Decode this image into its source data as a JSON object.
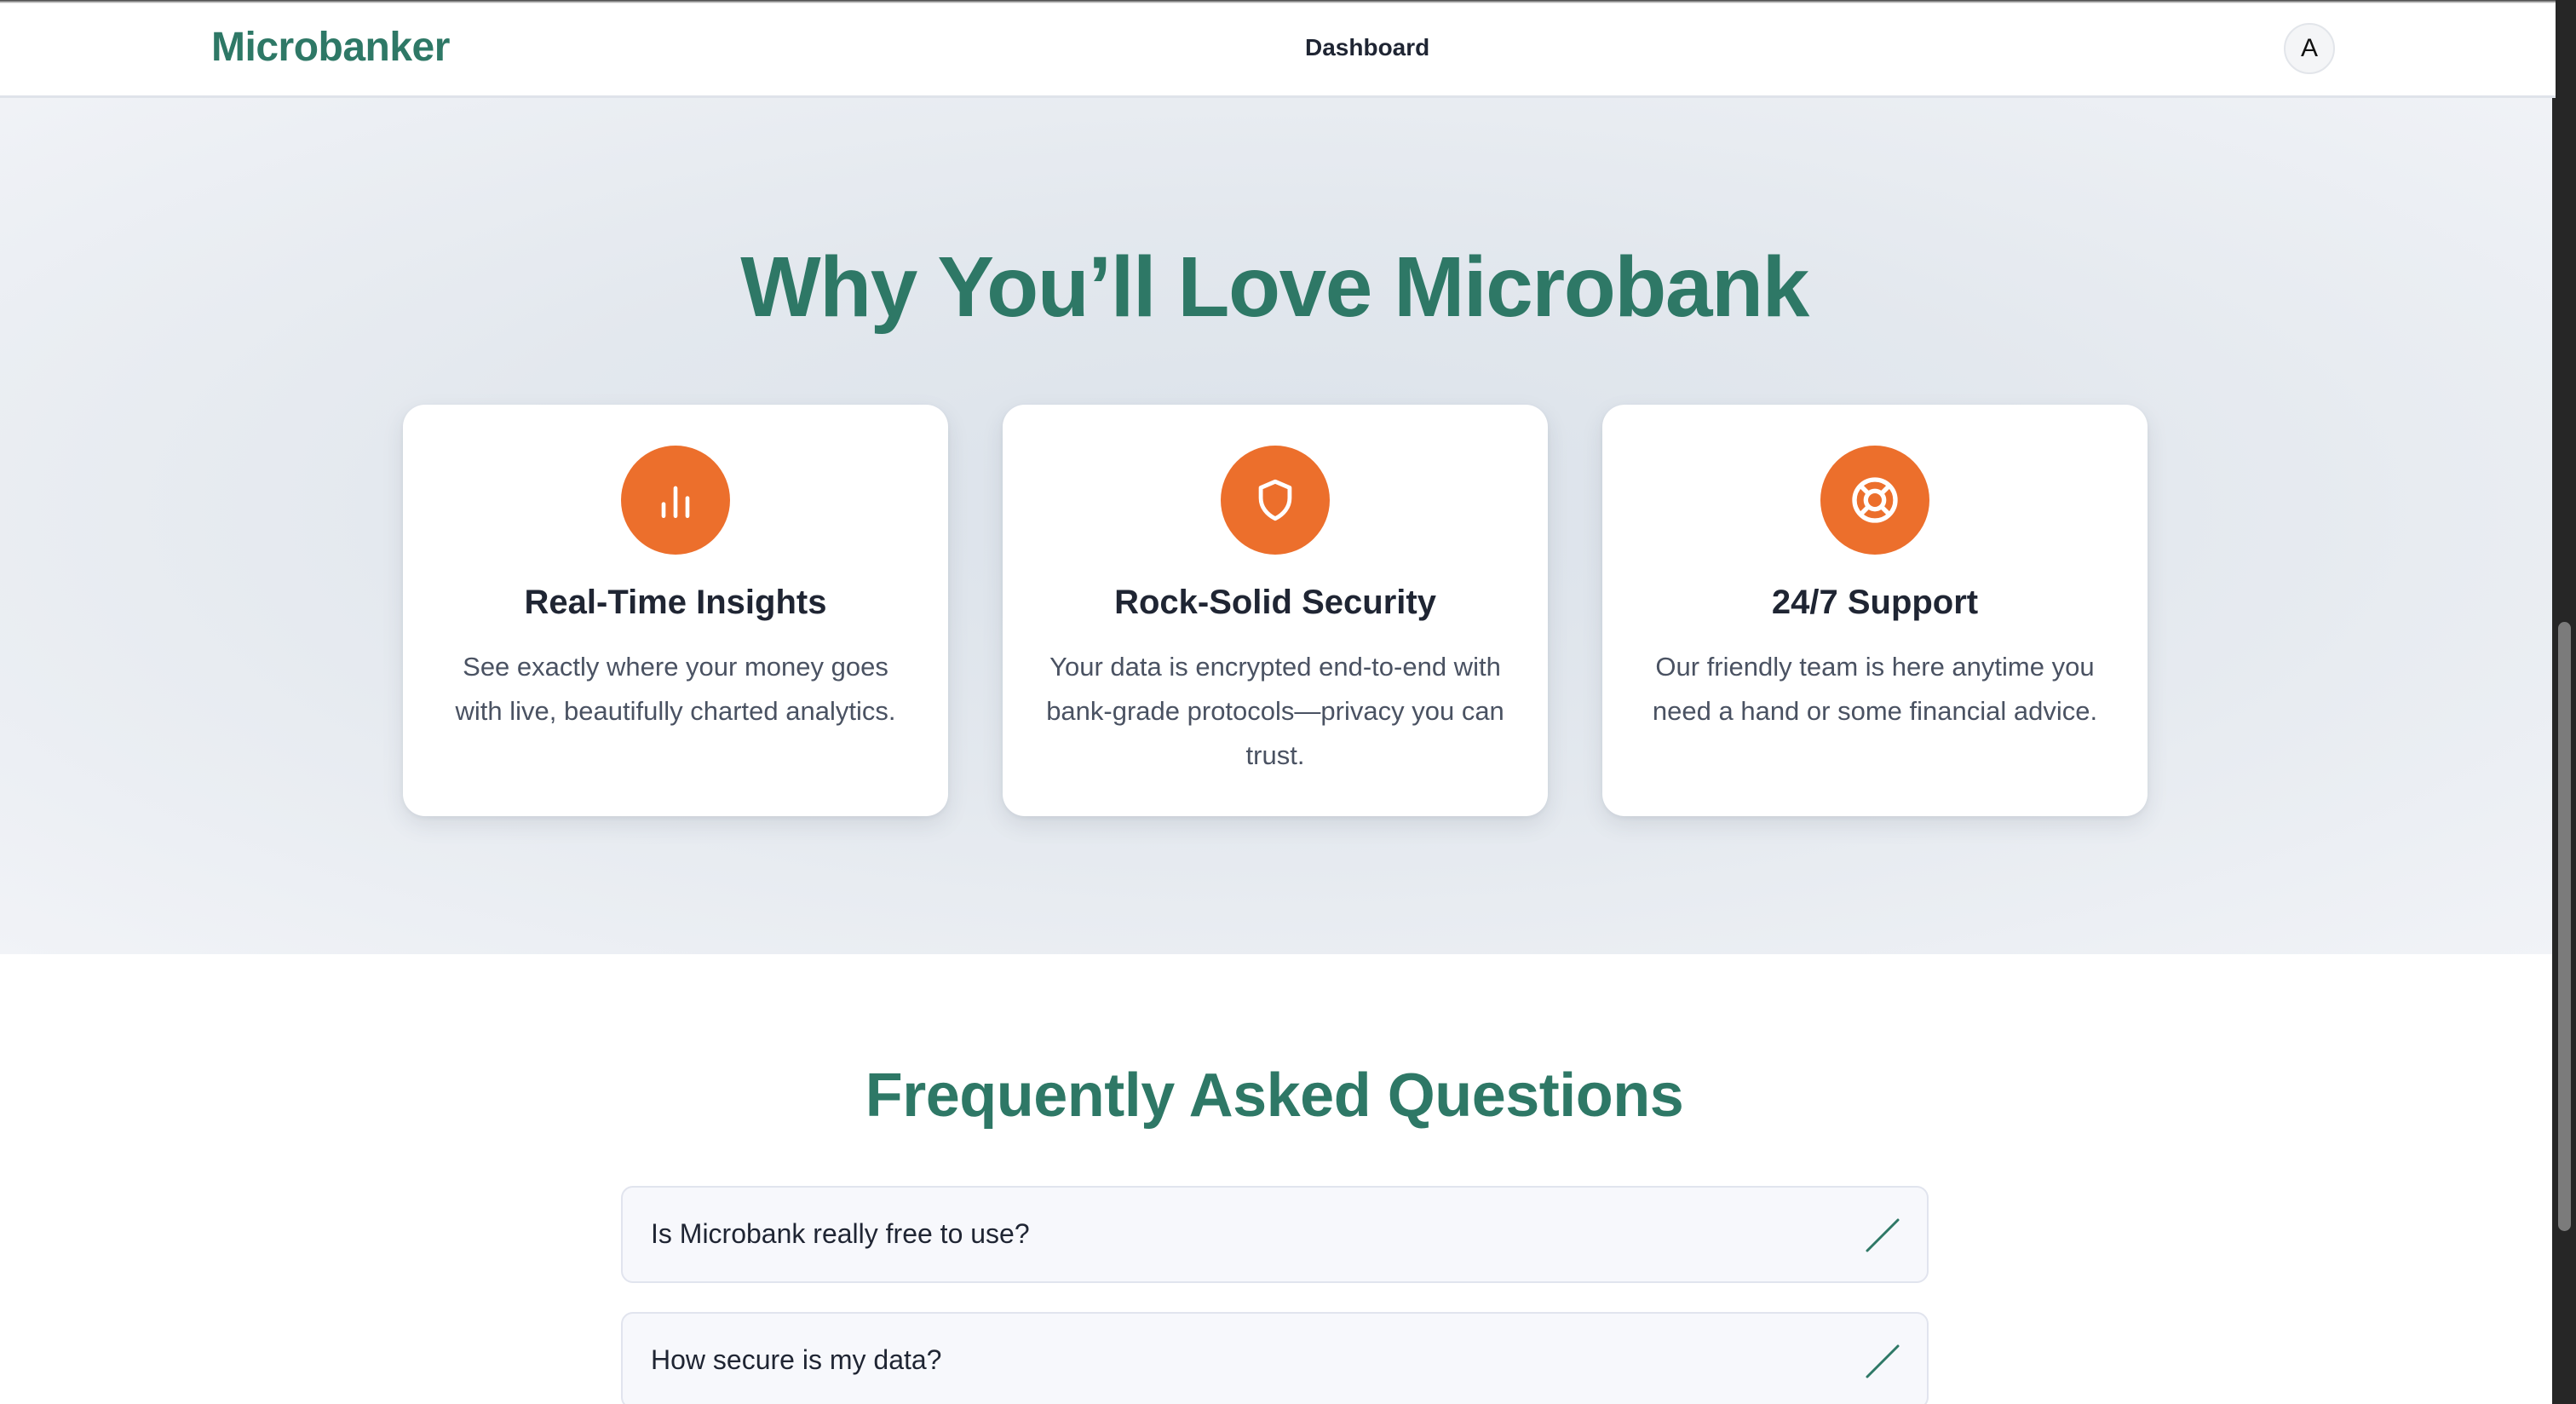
{
  "header": {
    "brand": "Microbanker",
    "nav_link": "Dashboard",
    "avatar_letter": "A"
  },
  "features": {
    "title": "Why You’ll Love Microbank",
    "cards": [
      {
        "icon": "bar-chart-icon",
        "title": "Real-Time Insights",
        "text": "See exactly where your money goes with live, beautifully charted analytics."
      },
      {
        "icon": "shield-icon",
        "title": "Rock-Solid Security",
        "text": "Your data is encrypted end-to-end with bank-grade protocols—privacy you can trust."
      },
      {
        "icon": "lifebuoy-icon",
        "title": "24/7 Support",
        "text": "Our friendly team is here anytime you need a hand or some financial advice."
      }
    ]
  },
  "faq": {
    "title": "Frequently Asked Questions",
    "items": [
      {
        "question": "Is Microbank really free to use?"
      },
      {
        "question": "How secure is my data?"
      }
    ]
  },
  "colors": {
    "brand_green": "#2e7866",
    "accent_orange": "#ec6f2c"
  }
}
